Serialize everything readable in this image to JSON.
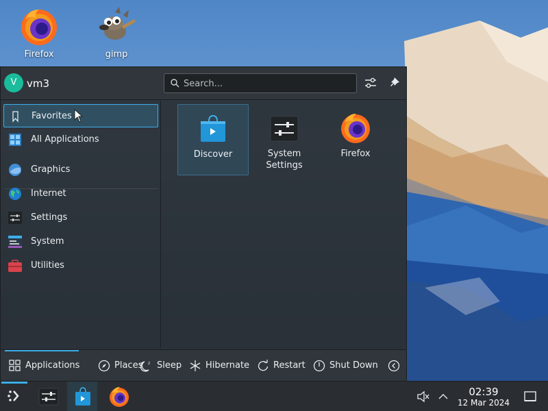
{
  "desktop": {
    "icons": [
      {
        "label": "Firefox",
        "icon": "firefox-icon"
      },
      {
        "label": "gimp",
        "icon": "gimp-icon"
      }
    ]
  },
  "menu": {
    "user": {
      "initial": "V",
      "name": "vm3"
    },
    "search": {
      "placeholder": "Search..."
    },
    "header_buttons": [
      {
        "icon": "configure-icon"
      },
      {
        "icon": "pin-icon"
      }
    ],
    "sidebar": {
      "items": [
        {
          "label": "Favorites",
          "icon": "bookmark-icon",
          "active": true
        },
        {
          "label": "All Applications",
          "icon": "all-apps-icon"
        },
        {
          "label": "Graphics",
          "icon": "graphics-icon"
        },
        {
          "label": "Internet",
          "icon": "internet-icon"
        },
        {
          "label": "Settings",
          "icon": "settings-icon"
        },
        {
          "label": "System",
          "icon": "system-icon"
        },
        {
          "label": "Utilities",
          "icon": "utilities-icon"
        }
      ]
    },
    "favorites": [
      {
        "label": "Discover",
        "icon": "discover-icon",
        "active": true
      },
      {
        "label": "System Settings",
        "icon": "system-settings-icon"
      },
      {
        "label": "Firefox",
        "icon": "firefox-icon"
      }
    ],
    "footer": {
      "applications": "Applications",
      "places": "Places",
      "sleep": "Sleep",
      "hibernate": "Hibernate",
      "restart": "Restart",
      "shutdown": "Shut Down"
    }
  },
  "taskbar": {
    "items": [
      {
        "icon": "application-launcher-icon"
      },
      {
        "icon": "system-settings-icon"
      },
      {
        "icon": "discover-icon"
      },
      {
        "icon": "firefox-icon"
      }
    ],
    "tray": {
      "volume_icon": "volume-muted-icon",
      "expand_icon": "chevron-up-icon"
    },
    "clock": {
      "time": "02:39",
      "date": "12 Mar 2024"
    },
    "show_desktop_icon": "show-desktop-icon"
  },
  "colors": {
    "accent": "#3daee9",
    "menu_bg": "#2a2e32",
    "taskbar_bg": "#2a2e32"
  }
}
